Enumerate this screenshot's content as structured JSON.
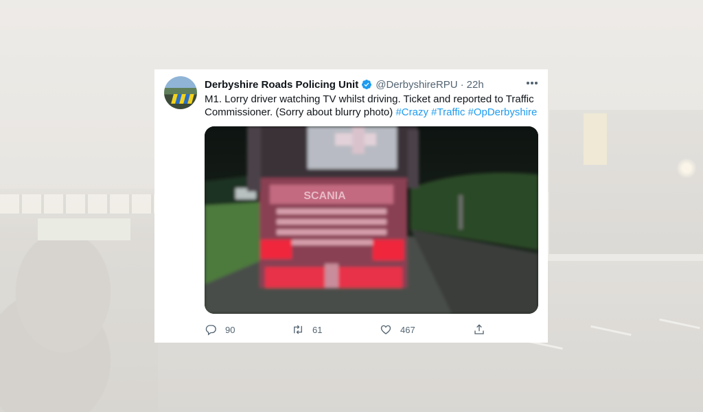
{
  "tweet": {
    "display_name": "Derbyshire Roads Policing Unit",
    "handle": "@DerbyshireRPU",
    "separator": "·",
    "time": "22h",
    "text_line1": "M1. Lorry driver watching TV whilst driving. Ticket and reported to Traffic",
    "text_line2_plain": "Commissioner. (Sorry about blurry photo)",
    "hashtags": [
      "#Crazy",
      "#Traffic",
      "#OpDerbyshire"
    ],
    "media_text": "SCANIA"
  },
  "actions": {
    "reply_count": "90",
    "retweet_count": "61",
    "like_count": "467"
  },
  "icons": {
    "verified": "verified-badge-icon",
    "more": "more-options-icon",
    "reply": "reply-icon",
    "retweet": "retweet-icon",
    "like": "like-icon",
    "share": "share-icon"
  },
  "colors": {
    "accent": "#1d9bf0",
    "text": "#0f1419",
    "secondary": "#536471"
  }
}
